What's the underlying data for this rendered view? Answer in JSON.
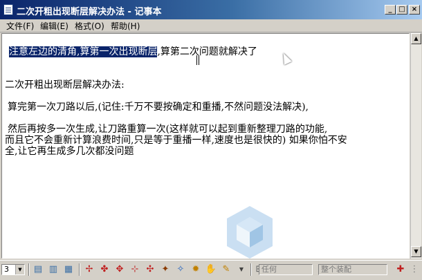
{
  "window": {
    "title": "二次开粗出现断层解决办法 - 记事本",
    "controls": {
      "minimize": "_",
      "maximize": "□",
      "close": "×"
    }
  },
  "menu": [
    {
      "label": "文件(F)"
    },
    {
      "label": "编辑(E)"
    },
    {
      "label": "格式(O)"
    },
    {
      "label": "帮助(H)"
    }
  ],
  "document": {
    "selected_text": "  注意左边的清角,算第一次出现断层",
    "line1_rest": ",算第二次问题就解决了",
    "heading": "二次开粗出现断层解决办法:",
    "para1": "    算完第一次刀路以后,(记住:千万不要按确定和重播,不然问题没法解决),",
    "para2_l1": "    然后再按多一次生成,让刀路重算一次(这样就可以起到重新整理刀路的功能,",
    "para2_l2": "而且它不会重新计算浪费时间,只是等于重播一样,速度也是很快的)  如果你怕不安",
    "para2_l3": "全,让它再生成多几次都没问题"
  },
  "toolbar": {
    "layer_value": "3",
    "combo_any": "任何",
    "combo_assembly": "整个装配"
  },
  "icons": {
    "arrow_up": "▲",
    "arrow_down": "▼"
  }
}
